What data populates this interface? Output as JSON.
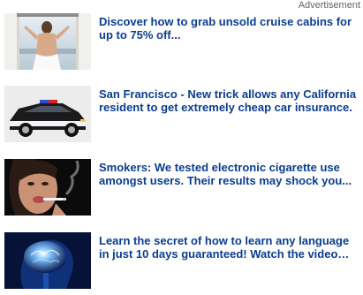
{
  "widget": {
    "label": "Advertisement",
    "items": [
      {
        "headline": "Discover how to grab unsold cruise cabins for up to 75% off...",
        "thumbnail": "woman-window-ocean-image"
      },
      {
        "headline": "San Francisco - New trick allows any California resident to get extremely cheap car insurance.",
        "thumbnail": "police-car-image"
      },
      {
        "headline": "Smokers: We tested electronic cigarette use amongst users. Their results may shock you...",
        "thumbnail": "woman-smoking-image"
      },
      {
        "headline": "Learn the secret of how to learn any language in just 10 days guaranteed! Watch the video…",
        "thumbnail": "glowing-brain-image"
      }
    ]
  },
  "colors": {
    "headline": "#0b3d91",
    "label": "#666666",
    "background": "#ffffff"
  }
}
